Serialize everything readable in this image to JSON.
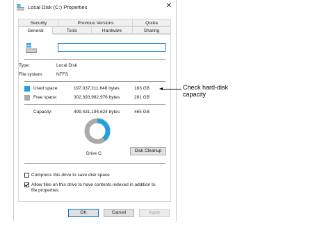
{
  "window": {
    "title": "Local Disk (C:) Properties",
    "close_glyph": "✕"
  },
  "tabs": {
    "row1": [
      "Security",
      "Previous Versions",
      "Quota"
    ],
    "row2": [
      "General",
      "Tools",
      "Hardware",
      "Sharing"
    ],
    "active": "General"
  },
  "general": {
    "drive_name_value": "",
    "type_label": "Type:",
    "type_value": "Local Disk",
    "fs_label": "File system:",
    "fs_value": "NTFS",
    "used_label": "Used space:",
    "used_bytes": "197,037,211,648 bytes",
    "used_gb": "183 GB",
    "free_label": "Free space:",
    "free_bytes": "302,393,982,976 bytes",
    "free_gb": "281 GB",
    "capacity_label": "Capacity:",
    "capacity_bytes": "499,431,194,624 bytes",
    "capacity_gb": "465 GB",
    "drive_label": "Drive C:",
    "cleanup_button": "Disk Cleanup",
    "compress_label": "Compress this drive to save disk space",
    "compress_checked": false,
    "index_label_line1": "Allow files on this drive to have contents indexed in addition to",
    "index_label_line2": "file properties",
    "index_checked": true,
    "used_fraction": 0.39
  },
  "colors": {
    "used": "#26a0da",
    "free": "#aaaaaa",
    "accent": "#0078d7"
  },
  "footer": {
    "ok": "OK",
    "cancel": "Cancel",
    "apply": "Apply"
  },
  "annotation": {
    "line1": "Check hard-disk",
    "line2": "capacity"
  },
  "icons": {
    "title": "drive-icon",
    "close": "close-icon",
    "drive": "windows-drive-icon"
  }
}
